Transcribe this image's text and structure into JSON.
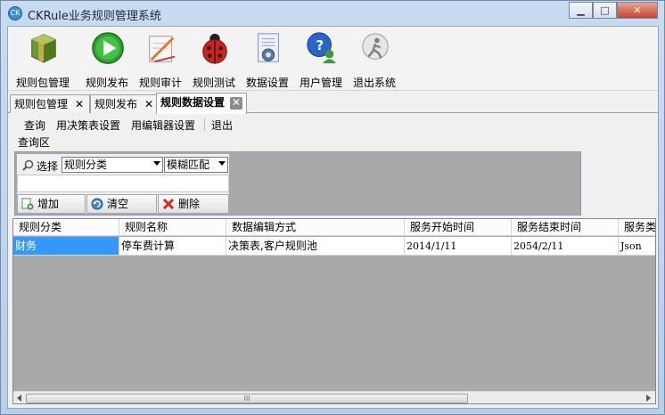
{
  "window": {
    "title": "CKRule业务规则管理系统",
    "minimize": "▁",
    "maximize": "□",
    "close": "✕"
  },
  "toolbar": {
    "items": [
      {
        "label": "规则包管理",
        "icon": "package-icon"
      },
      {
        "label": "规则发布",
        "icon": "play-icon"
      },
      {
        "label": "规则审计",
        "icon": "audit-pencil-icon"
      },
      {
        "label": "规则测试",
        "icon": "ladybug-icon"
      },
      {
        "label": "数据设置",
        "icon": "document-gear-icon"
      },
      {
        "label": "用户管理",
        "icon": "user-chat-icon"
      },
      {
        "label": "退出系统",
        "icon": "exit-figure-icon"
      }
    ]
  },
  "tabs": [
    {
      "label": "规则包管理",
      "close": "✕"
    },
    {
      "label": "规则发布",
      "close": "✕"
    },
    {
      "label": "规则数据设置",
      "close": "✕",
      "active": true
    }
  ],
  "menu": {
    "items": [
      "查询",
      "用决策表设置",
      "用编辑器设置",
      "退出"
    ]
  },
  "query": {
    "section_label": "查询区",
    "select_label": "选择",
    "category_select": "规则分类",
    "match_select": "模糊匹配",
    "input_value": "",
    "add_button": "增加",
    "clear_button": "清空",
    "delete_button": "删除"
  },
  "table": {
    "columns": [
      "规则分类",
      "规则名称",
      "数据编辑方式",
      "服务开始时间",
      "服务结束时间",
      "服务类"
    ],
    "rows": [
      [
        "财务",
        "停车费计算",
        "决策表,客户规则池",
        "2014/1/11",
        "2054/2/11",
        "Json"
      ]
    ],
    "scroll_grip": "III"
  },
  "colors": {
    "selection": "#3399ff",
    "grid_bg": "#a9a9a9",
    "title_bg": "#c9dbef"
  }
}
